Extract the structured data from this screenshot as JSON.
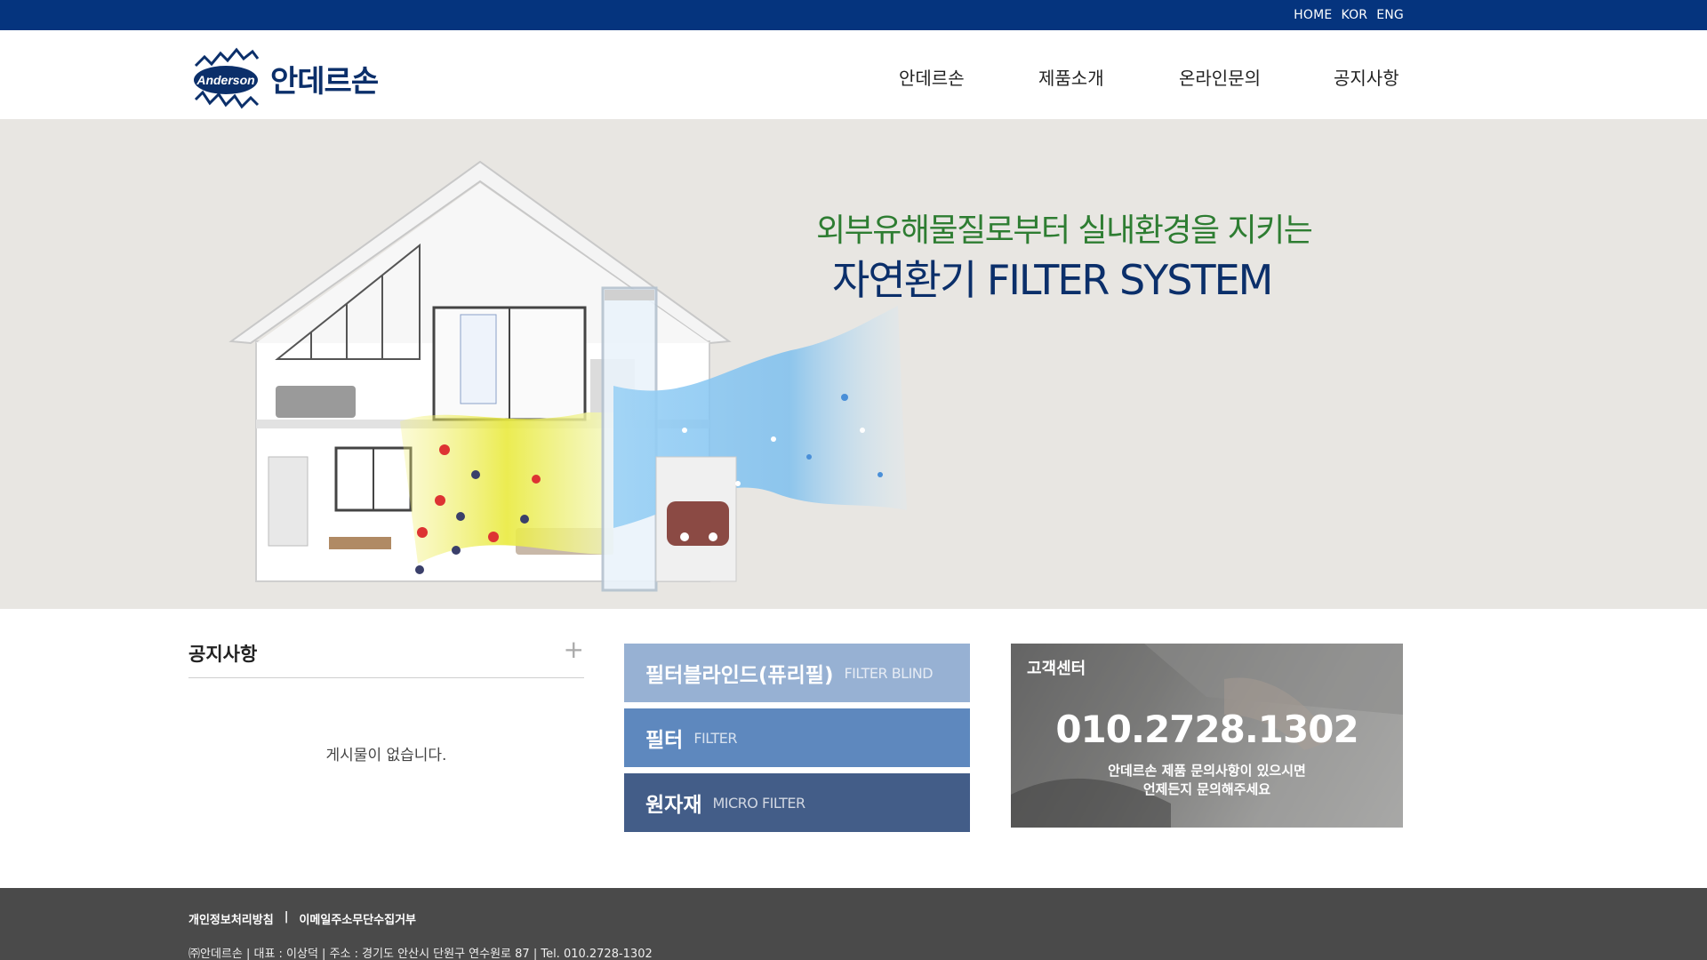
{
  "topbar": {
    "links": [
      "HOME",
      "KOR",
      "ENG"
    ]
  },
  "header": {
    "logo_mark_text": "Anderson",
    "logo_text": "안데르손",
    "nav": [
      "안데르손",
      "제품소개",
      "온라인문의",
      "공지사항"
    ]
  },
  "hero": {
    "subtitle": "외부유해물질로부터 실내환경을 지키는",
    "title": "자연환기 FILTER SYSTEM"
  },
  "notice": {
    "title": "공지사항",
    "more": "+",
    "empty": "게시물이 없습니다."
  },
  "products": [
    {
      "ko": "필터블라인드(퓨리필)",
      "en": "FILTER BLIND"
    },
    {
      "ko": "필터",
      "en": "FILTER"
    },
    {
      "ko": "원자재",
      "en": "MICRO FILTER"
    }
  ],
  "customer_center": {
    "title": "고객센터",
    "phone": "010.2728.1302",
    "desc_line1": "안데르손 제품 문의사항이 있으시면",
    "desc_line2": "언제든지 문의해주세요"
  },
  "footer": {
    "links": [
      "개인정보처리방침",
      "|",
      "이메일주소무단수집거부"
    ],
    "info": "㈜안데르손  |  대표 : 이상덕  |  주소 : 경기도 안산시 단원구 연수원로 87  |  Tel. 010.2728-1302"
  },
  "colors": {
    "topbar": "#05347e",
    "brand_navy": "#0b2f6a",
    "hero_green": "#2e7d32",
    "hero_bg": "#e8e6e2",
    "product1": "#97b1d3",
    "product2": "#5e88be",
    "product3": "#435d88",
    "footer": "#4a4a4a"
  }
}
